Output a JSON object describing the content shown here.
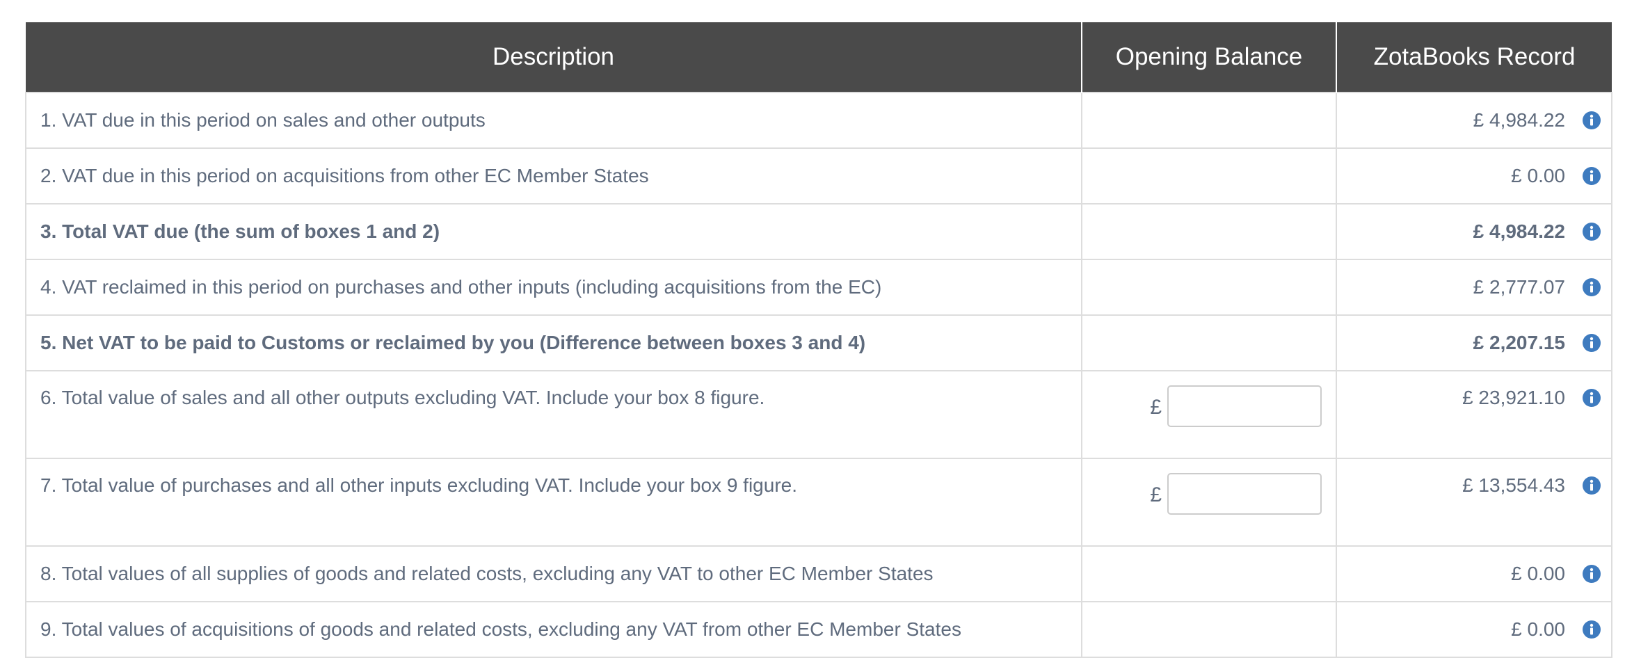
{
  "table": {
    "headers": {
      "description": "Description",
      "opening_balance": "Opening Balance",
      "record": "ZotaBooks Record"
    },
    "currency_symbol": "£",
    "rows": [
      {
        "description": "1. VAT due in this period on sales and other outputs",
        "record": "£ 4,984.22"
      },
      {
        "description": "2. VAT due in this period on acquisitions from other EC Member States",
        "record": "£ 0.00"
      },
      {
        "description": "3. Total VAT due (the sum of boxes 1 and 2)",
        "record": "£ 4,984.22"
      },
      {
        "description": "4. VAT reclaimed in this period on purchases and other inputs (including acquisitions from the EC)",
        "record": "£ 2,777.07"
      },
      {
        "description": "5. Net VAT to be paid to Customs or reclaimed by you (Difference between boxes 3 and 4)",
        "record": "£ 2,207.15"
      },
      {
        "description": "6. Total value of sales and all other outputs excluding VAT. Include your box 8 figure.",
        "record": "£ 23,921.10",
        "opening_value": ""
      },
      {
        "description": "7. Total value of purchases and all other inputs excluding VAT. Include your box 9 figure.",
        "record": "£ 13,554.43",
        "opening_value": ""
      },
      {
        "description": "8. Total values of all supplies of goods and related costs, excluding any VAT to other EC Member States",
        "record": "£ 0.00"
      },
      {
        "description": "9. Total values of acquisitions of goods and related costs, excluding any VAT from other EC Member States",
        "record": "£ 0.00"
      }
    ]
  },
  "colors": {
    "header_bg": "#4a4a4a",
    "text": "#5f6b7d",
    "info_icon": "#3e7bbf",
    "border": "#dddddd"
  },
  "icons": {
    "info": "info-icon"
  }
}
